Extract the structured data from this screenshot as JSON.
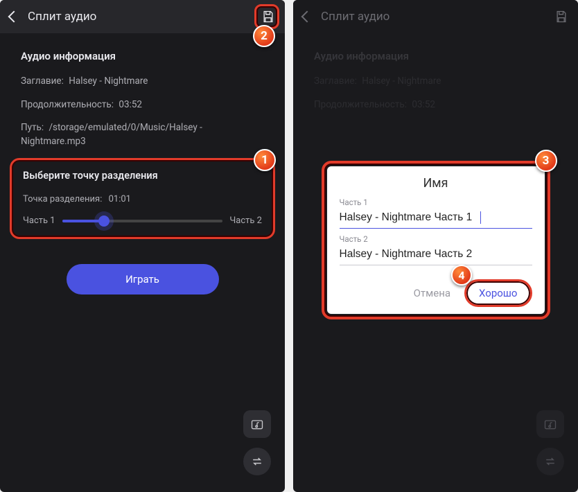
{
  "left": {
    "title": "Сплит аудио",
    "info_heading": "Аудио информация",
    "title_label": "Заглавие:",
    "title_value": "Halsey - Nightmare",
    "duration_label": "Продолжительность:",
    "duration_value": "03:52",
    "path_label": "Путь:",
    "path_value": "/storage/emulated/0/Music/Halsey - Nightmare.mp3",
    "split_heading": "Выберите точку разделения",
    "split_point_label": "Точка разделения:",
    "split_point_value": "01:01",
    "part1": "Часть 1",
    "part2": "Часть 2",
    "play": "Играть"
  },
  "right": {
    "title": "Сплит аудио",
    "info_heading": "Аудио информация",
    "title_label": "Заглавие:",
    "title_value": "Halsey - Nightmare",
    "duration_label": "Продолжительность:",
    "duration_value": "03:52"
  },
  "dialog": {
    "title": "Имя",
    "p1_label": "Часть 1",
    "p1_value": "Halsey - Nightmare Часть 1",
    "p2_label": "Часть 2",
    "p2_value": "Halsey - Nightmare Часть 2",
    "cancel": "Отмена",
    "ok": "Хорошо"
  },
  "badges": {
    "b1": "1",
    "b2": "2",
    "b3": "3",
    "b4": "4"
  }
}
